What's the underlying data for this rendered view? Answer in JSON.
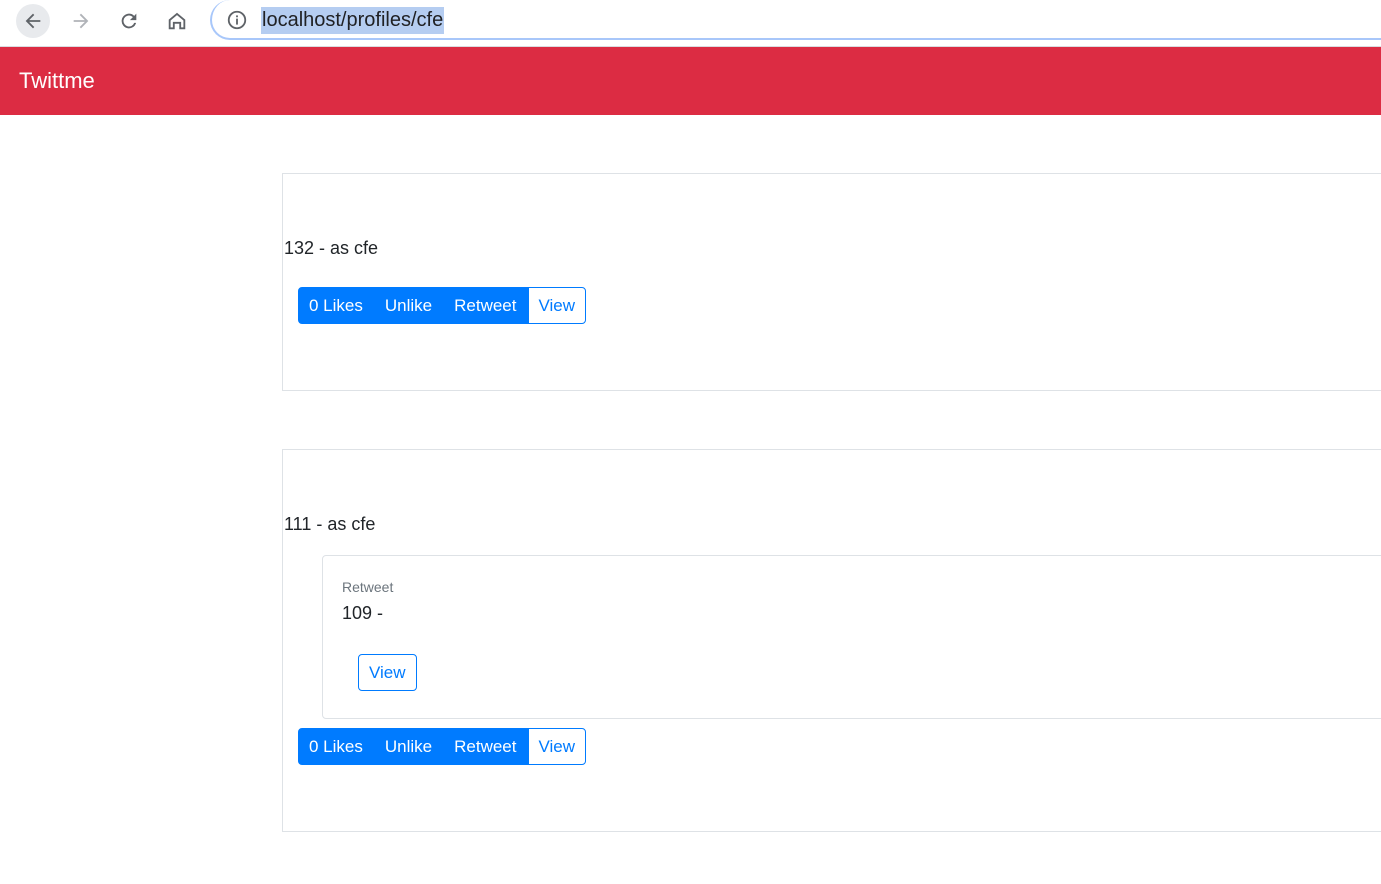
{
  "browser": {
    "url": "localhost/profiles/cfe",
    "icons": [
      "back-arrow-icon",
      "forward-arrow-icon",
      "reload-icon",
      "home-icon",
      "info-icon"
    ]
  },
  "navbar": {
    "brand": "Twittme",
    "color": "#dc2c43"
  },
  "tweets": [
    {
      "text": "132 - as cfe",
      "buttons": {
        "likes": "0 Likes",
        "unlike": "Unlike",
        "retweet": "Retweet",
        "view": "View"
      }
    },
    {
      "text": "111 - as cfe",
      "retweet": {
        "label": "Retweet",
        "text": "109 -",
        "view": "View"
      },
      "buttons": {
        "likes": "0 Likes",
        "unlike": "Unlike",
        "retweet": "Retweet",
        "view": "View"
      }
    }
  ],
  "colors": {
    "primary": "#007bff",
    "border": "#dee2e6",
    "muted": "#6c757d"
  }
}
